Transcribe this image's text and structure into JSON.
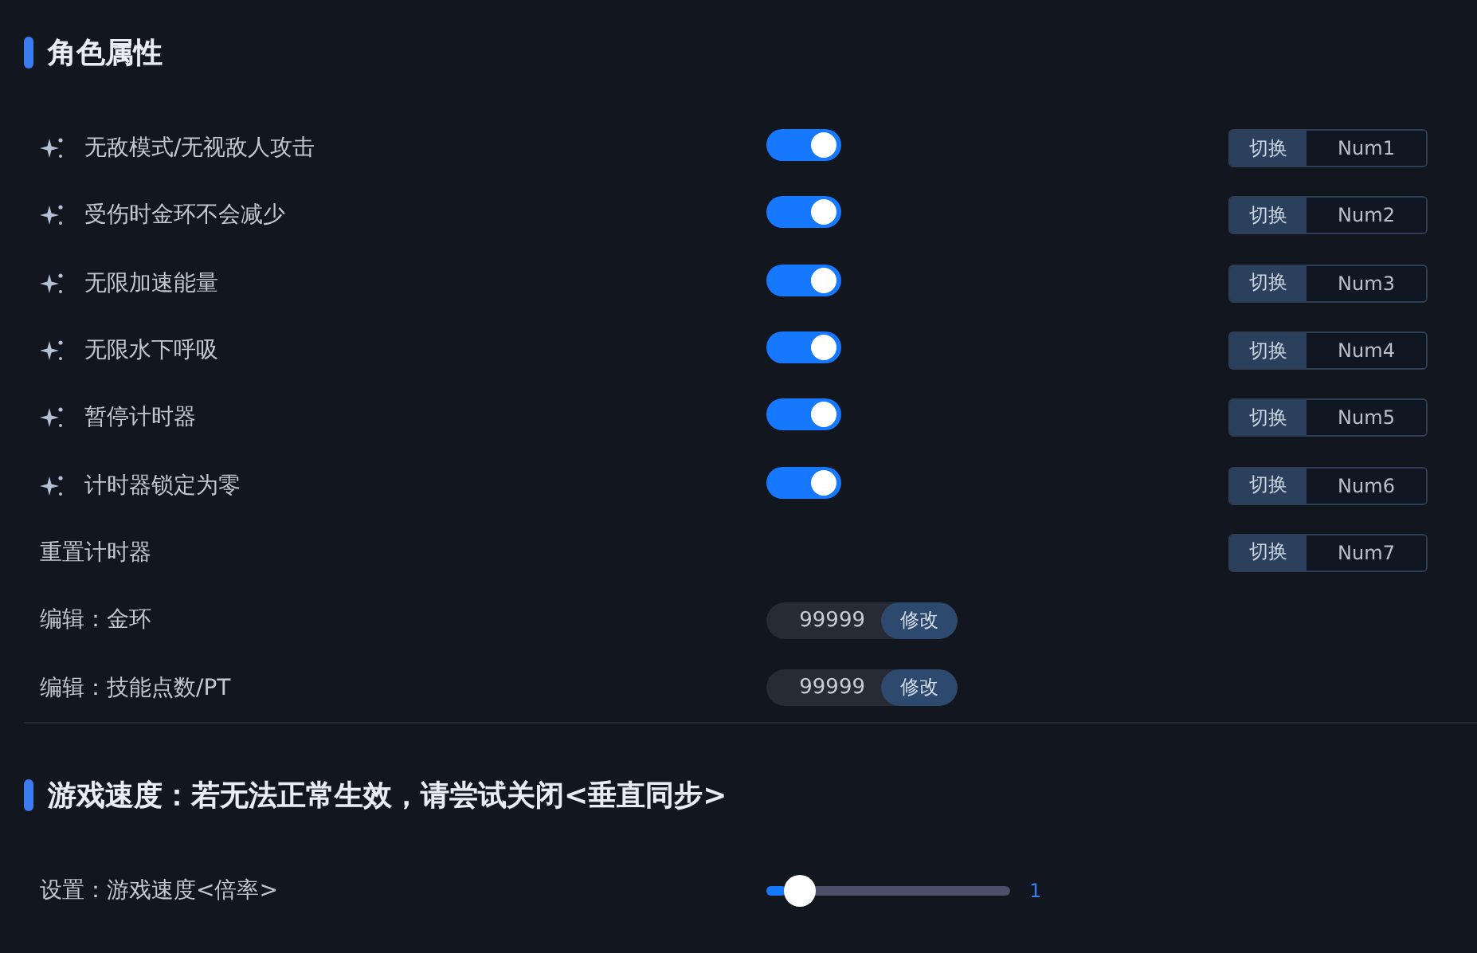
{
  "sections": [
    {
      "title": "角色属性",
      "rows": [
        {
          "kind": "toggle",
          "label": "无敌模式/无视敌人攻击",
          "on": true,
          "action": "切换",
          "hotkey": "Num1"
        },
        {
          "kind": "toggle",
          "label": "受伤时金环不会减少",
          "on": true,
          "action": "切换",
          "hotkey": "Num2"
        },
        {
          "kind": "toggle",
          "label": "无限加速能量",
          "on": true,
          "action": "切换",
          "hotkey": "Num3"
        },
        {
          "kind": "toggle",
          "label": "无限水下呼吸",
          "on": true,
          "action": "切换",
          "hotkey": "Num4"
        },
        {
          "kind": "toggle",
          "label": "暂停计时器",
          "on": true,
          "action": "切换",
          "hotkey": "Num5"
        },
        {
          "kind": "toggle",
          "label": "计时器锁定为零",
          "on": true,
          "action": "切换",
          "hotkey": "Num6"
        },
        {
          "kind": "button",
          "label": "重置计时器",
          "action": "切换",
          "hotkey": "Num7"
        },
        {
          "kind": "edit",
          "label": "编辑：金环",
          "value": "99999",
          "button": "修改"
        },
        {
          "kind": "edit",
          "label": "编辑：技能点数/PT",
          "value": "99999",
          "button": "修改"
        }
      ]
    },
    {
      "title": "游戏速度：若无法正常生效，请尝试关闭<垂直同步>",
      "rows": [
        {
          "kind": "slider",
          "label": "设置：游戏速度<倍率>",
          "level": 0.08,
          "reading": "1"
        }
      ]
    }
  ]
}
